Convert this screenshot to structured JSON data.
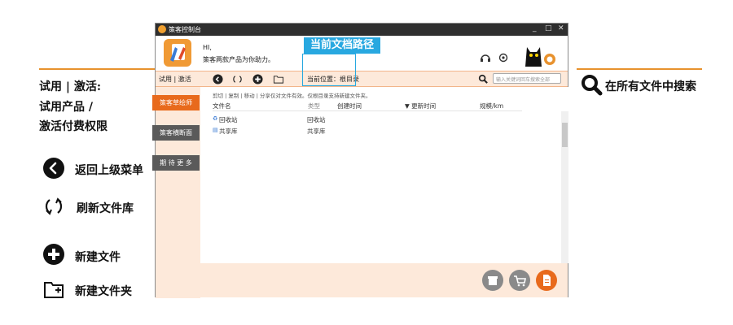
{
  "annotations": {
    "trial_activate": "试用 | 激活:",
    "trial_product": "试用产品 /",
    "activate_rights": "激活付费权限",
    "back": "返回上级菜单",
    "refresh": "刷新文件库",
    "new_file": "新建文件",
    "new_folder": "新建文件夹",
    "search_all": "在所有文件中搜索",
    "current_path": "当前文档路径"
  },
  "window": {
    "title": "策客控制台",
    "controls": [
      "_",
      "□",
      "✕"
    ]
  },
  "header": {
    "greeting": "HI,",
    "tagline": "策客两款产品为你助力。"
  },
  "toolbar": {
    "trial_label": "试用 | 激活",
    "location_label": "当前位置：根目录",
    "search_placeholder": "输入关键词回车搜索全部"
  },
  "sidebar": {
    "items": [
      {
        "label": "策客草绘师",
        "active": true
      },
      {
        "label": "策客横断面",
        "active": false
      },
      {
        "label": "期 待 更 多",
        "active": false
      }
    ]
  },
  "content": {
    "hint": "剪切 | 复制 | 移动 | 分享仅对文件有效。仅根目录支持新建文件夹。",
    "columns": [
      "文件名",
      "类型",
      "创建时间",
      "▼ 更新时间",
      "规模/km"
    ],
    "rows": [
      {
        "name": "回收站",
        "type": "回收站"
      },
      {
        "name": "共享库",
        "type": "共享库"
      }
    ]
  },
  "colors": {
    "accent": "#e8922e",
    "active_tab": "#e86a1c",
    "inactive_tab": "#5a5a5a",
    "toolbar_bg": "#fde9da",
    "callout": "#28a8e0"
  }
}
